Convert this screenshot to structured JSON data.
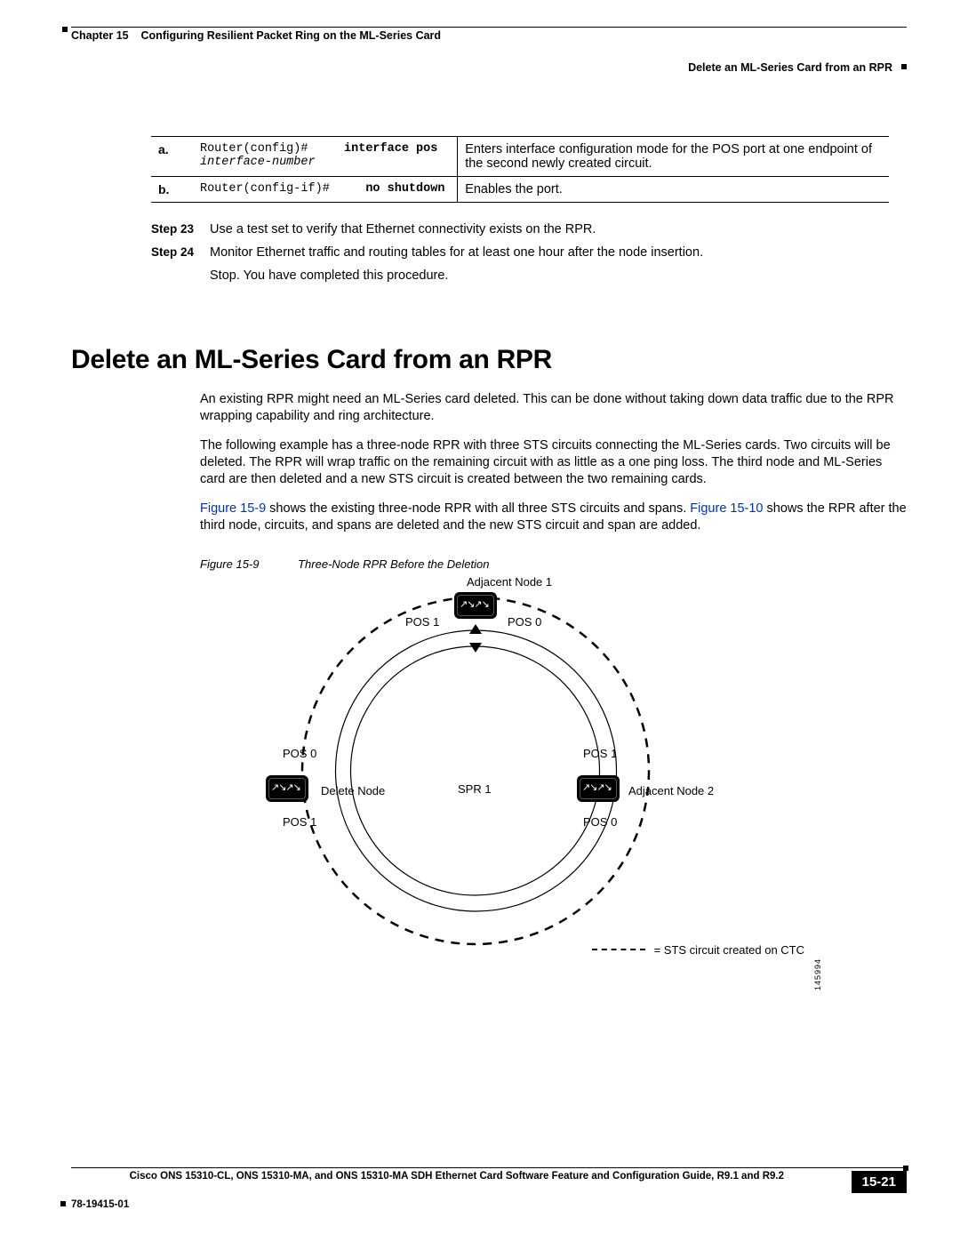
{
  "header": {
    "chapter_num": "Chapter 15",
    "chapter_title": "Configuring Resilient Packet Ring on the ML-Series Card",
    "breadcrumb": "Delete an ML-Series Card from an RPR"
  },
  "table": {
    "rows": [
      {
        "label": "a.",
        "prompt": "Router(config)#",
        "cmd_bold": "interface pos",
        "cmd_ital": "interface-number",
        "desc": "Enters interface configuration mode for the POS port at one endpoint of the second newly created circuit."
      },
      {
        "label": "b.",
        "prompt": "Router(config-if)#",
        "cmd_bold": "no shutdown",
        "cmd_ital": "",
        "desc": "Enables the port."
      }
    ]
  },
  "steps": [
    {
      "label": "Step 23",
      "text": "Use a test set to verify that Ethernet connectivity exists on the RPR."
    },
    {
      "label": "Step 24",
      "text": "Monitor Ethernet traffic and routing tables for at least one hour after the node insertion."
    }
  ],
  "stop_line": "Stop. You have completed this procedure.",
  "section_title": "Delete an ML-Series Card from an RPR",
  "paragraphs": {
    "p1": "An existing RPR might need an ML-Series card deleted. This can be done without taking down data traffic due to the RPR wrapping capability and ring architecture.",
    "p2": "The following example has a three-node RPR with three STS circuits connecting the ML-Series cards. Two circuits will be deleted. The RPR will wrap traffic on the remaining circuit with as little as a one ping loss. The third node and ML-Series card are then deleted and a new STS circuit is created between the two remaining cards.",
    "p3_pre": "",
    "fig_link_a": "Figure 15-9",
    "p3_mid": " shows the existing three-node RPR with all three STS circuits and spans. ",
    "fig_link_b": "Figure 15-10",
    "p3_post": " shows the RPR after the third node, circuits, and spans are deleted and the new STS circuit and span are added."
  },
  "figure": {
    "num": "Figure 15-9",
    "title": "Three-Node RPR Before the Deletion",
    "labels": {
      "adj1": "Adjacent Node 1",
      "adj2": "Adjacent Node 2",
      "delete": "Delete Node",
      "spr": "SPR 1",
      "pos0": "POS 0",
      "pos1": "POS 1"
    },
    "legend": "= STS circuit created on CTC",
    "imgid": "145994"
  },
  "footer": {
    "doc_title": "Cisco ONS 15310-CL, ONS 15310-MA, and ONS 15310-MA SDH Ethernet Card Software Feature and Configuration Guide, R9.1 and R9.2",
    "doc_num": "78-19415-01",
    "page_num": "15-21"
  }
}
